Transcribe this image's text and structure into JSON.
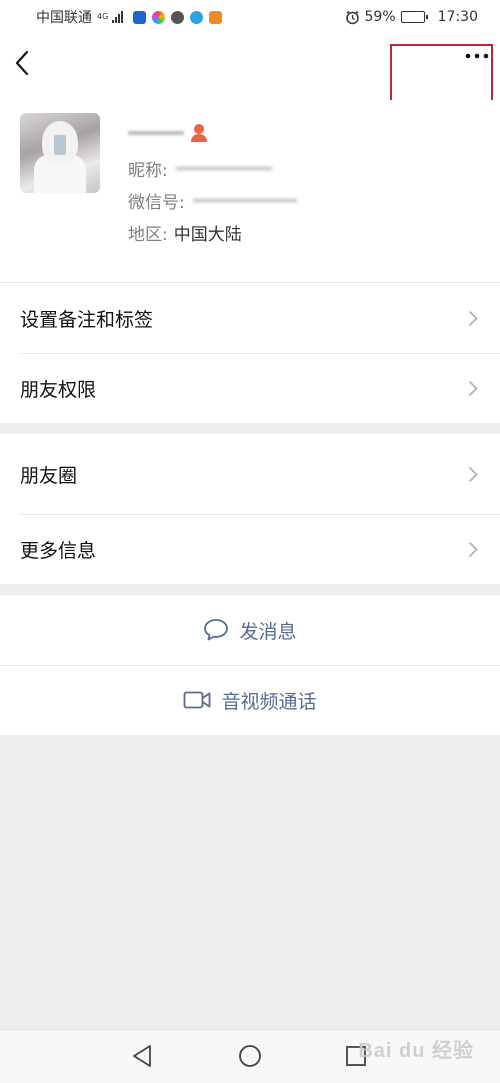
{
  "status_bar": {
    "carrier": "中国联通",
    "network": "4G",
    "battery_percent": "59%",
    "battery_level": 0.59,
    "time": "17:30",
    "app_icons": [
      "shield-app-icon",
      "colorful-app-icon",
      "chat-bubble-icon",
      "telegram-icon",
      "video-app-icon"
    ],
    "alarm_icon": "alarm-clock-icon"
  },
  "navbar": {
    "back_icon": "back-arrow-icon",
    "more_icon": "more-dots-icon"
  },
  "profile": {
    "nickname_label": "昵称:",
    "wechat_id_label": "微信号:",
    "region_label": "地区:",
    "region_value": "中国大陆",
    "gender_icon": "female-user-icon"
  },
  "menu_group_1": [
    {
      "label": "设置备注和标签"
    },
    {
      "label": "朋友权限"
    }
  ],
  "menu_group_2": [
    {
      "label": "朋友圈"
    },
    {
      "label": "更多信息"
    }
  ],
  "actions": {
    "send_message": "发消息",
    "video_call": "音视频通话"
  },
  "colors": {
    "highlight_box": "#c0272d",
    "link_blue": "#576b95",
    "background": "#ededed"
  },
  "watermark": "Bai du 经验"
}
